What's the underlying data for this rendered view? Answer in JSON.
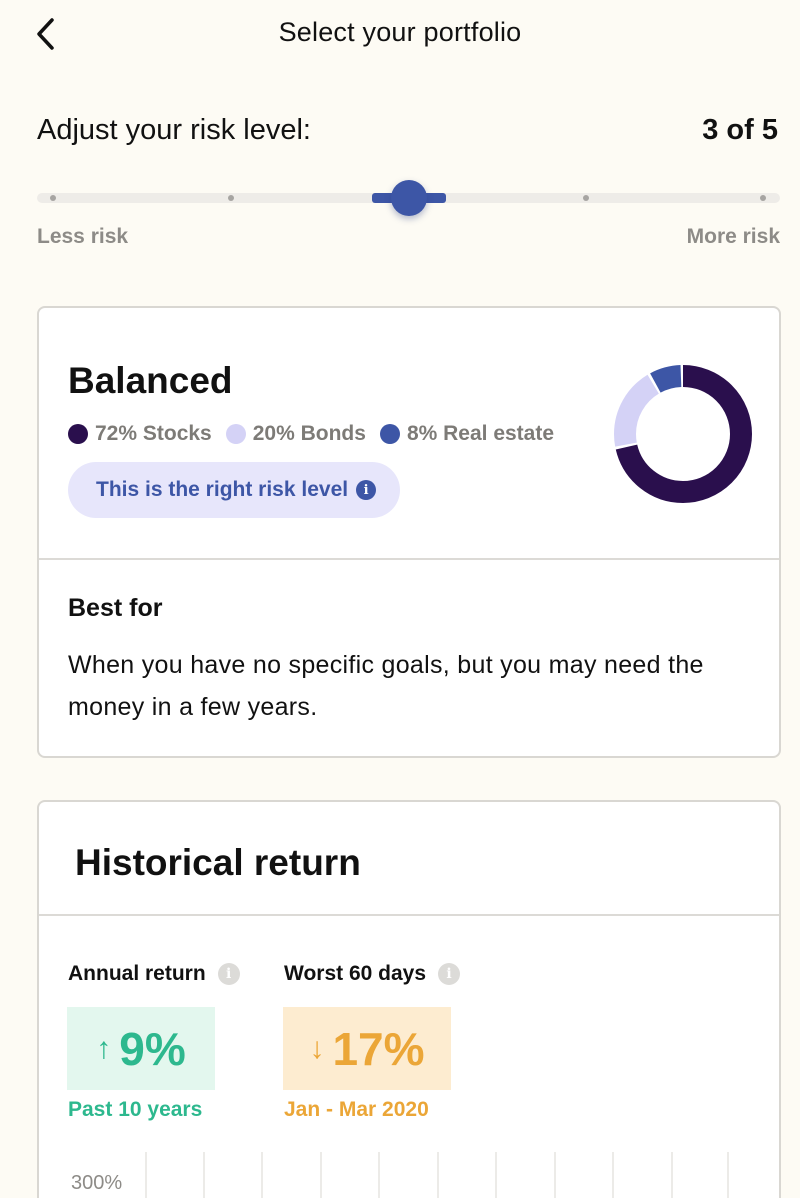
{
  "header": {
    "title": "Select your portfolio"
  },
  "risk": {
    "label": "Adjust your risk level:",
    "value_text": "3 of 5",
    "current_level": 3,
    "max_level": 5,
    "min_caption": "Less risk",
    "max_caption": "More risk"
  },
  "portfolio": {
    "name": "Balanced",
    "allocations": [
      {
        "label": "72% Stocks",
        "percent": 72,
        "color": "#2a0f4d"
      },
      {
        "label": "20% Bonds",
        "percent": 20,
        "color": "#d4d2f6"
      },
      {
        "label": "8% Real estate",
        "percent": 8,
        "color": "#3d56a6"
      }
    ],
    "risk_pill": "This is the right risk level",
    "best_for_label": "Best for",
    "best_for_text": "When you have no specific goals, but you may need the money in a few years."
  },
  "history": {
    "title": "Historical return",
    "annual": {
      "label": "Annual return",
      "arrow": "↑",
      "value": "9%",
      "period": "Past 10 years",
      "color": "#2db88e"
    },
    "worst": {
      "label": "Worst 60 days",
      "arrow": "↓",
      "value": "17%",
      "period": "Jan - Mar 2020",
      "color": "#eba637"
    },
    "chart_axis_tick": "300%"
  },
  "icons": {
    "back": "chevron-left-icon",
    "info": "info-icon"
  }
}
